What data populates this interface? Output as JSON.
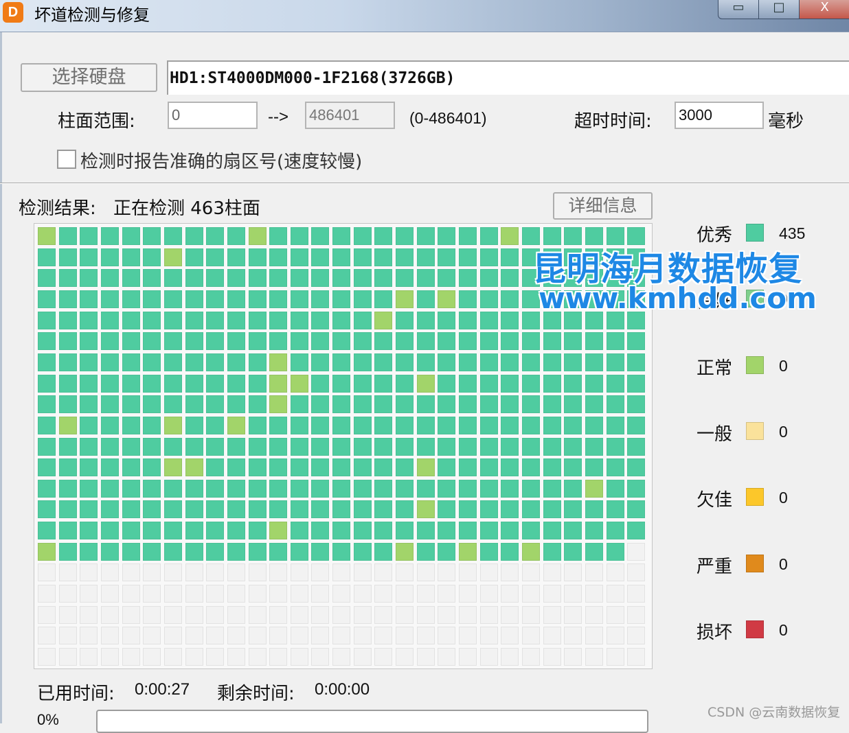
{
  "window": {
    "title": "坏道检测与修复",
    "icon_text": "D",
    "minimize_glyph": "▭",
    "maximize_glyph": "□",
    "close_glyph": "X"
  },
  "toolbar": {
    "select_disk_label": "选择硬盘",
    "disk_text": "HD1:ST4000DM000-1F2168(3726GB)",
    "cylinder_range_label": "柱面范围:",
    "cylinder_start": "0",
    "arrow": "-->",
    "cylinder_end": "486401",
    "range_hint": "(0-486401)",
    "timeout_label": "超时时间:",
    "timeout_value": "3000",
    "timeout_unit": "毫秒",
    "accurate_sector_label": "检测时报告准确的扇区号(速度较慢)",
    "accurate_sector_checked": false
  },
  "result": {
    "label": "检测结果:",
    "status": "正在检测 463柱面",
    "details_button": "详细信息"
  },
  "grid": {
    "columns": 29,
    "rows": 21,
    "filled_rows": 16,
    "colors": {
      "excellent": "#4fcca0",
      "normal": "#a2d46a",
      "empty": "#f2f2f2"
    },
    "normal_cells": [
      [
        0,
        0
      ],
      [
        0,
        10
      ],
      [
        0,
        22
      ],
      [
        1,
        6
      ],
      [
        3,
        17
      ],
      [
        3,
        19
      ],
      [
        4,
        16
      ],
      [
        6,
        11
      ],
      [
        7,
        11
      ],
      [
        7,
        12
      ],
      [
        7,
        18
      ],
      [
        8,
        11
      ],
      [
        9,
        1
      ],
      [
        9,
        6
      ],
      [
        9,
        9
      ],
      [
        11,
        6
      ],
      [
        11,
        7
      ],
      [
        11,
        18
      ],
      [
        12,
        26
      ],
      [
        13,
        18
      ],
      [
        14,
        11
      ],
      [
        15,
        0
      ],
      [
        15,
        17
      ],
      [
        15,
        20
      ],
      [
        15,
        23
      ]
    ],
    "empty_cells_in_filled_rows": [
      [
        15,
        28
      ]
    ]
  },
  "legend": [
    {
      "label": "优秀",
      "color": "#4fcca0",
      "count": "435"
    },
    {
      "label": "良好",
      "color": "#7fcf8c",
      "count": "0"
    },
    {
      "label": "正常",
      "color": "#a2d46a",
      "count": "0"
    },
    {
      "label": "一般",
      "color": "#fae29b",
      "count": "0"
    },
    {
      "label": "欠佳",
      "color": "#fcc72a",
      "count": "0"
    },
    {
      "label": "严重",
      "color": "#e08a1c",
      "count": "0"
    },
    {
      "label": "损坏",
      "color": "#d03a44",
      "count": "0"
    }
  ],
  "status": {
    "elapsed_label": "已用时间:",
    "elapsed_value": "0:00:27",
    "remaining_label": "剩余时间:",
    "remaining_value": "0:00:00",
    "progress_text": "0%",
    "progress_value": 0
  },
  "watermark": {
    "cn": "昆明海月数据恢复",
    "url": "www.kmhdd.com"
  },
  "csdn": "CSDN @云南数据恢复"
}
